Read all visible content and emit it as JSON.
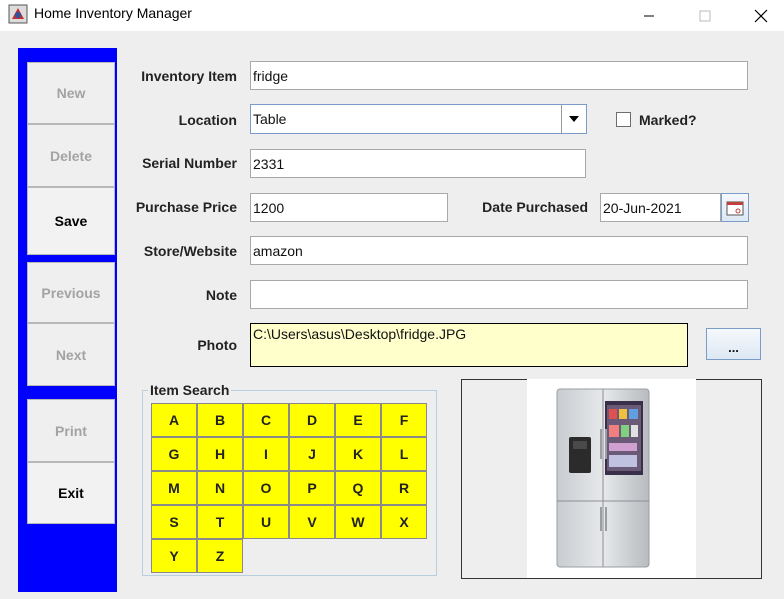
{
  "window": {
    "title": "Home Inventory Manager"
  },
  "sidebar": {
    "new": "New",
    "delete": "Delete",
    "save": "Save",
    "previous": "Previous",
    "next": "Next",
    "print": "Print",
    "exit": "Exit"
  },
  "form": {
    "inventory_item": {
      "label": "Inventory Item",
      "value": "fridge"
    },
    "location": {
      "label": "Location",
      "value": "Table"
    },
    "marked": {
      "label": "Marked?",
      "checked": false
    },
    "serial_number": {
      "label": "Serial Number",
      "value": "2331"
    },
    "purchase_price": {
      "label": "Purchase Price",
      "value": "1200"
    },
    "date_purchased": {
      "label": "Date Purchased",
      "value": "20-Jun-2021"
    },
    "store_website": {
      "label": "Store/Website",
      "value": "amazon"
    },
    "note": {
      "label": "Note",
      "value": ""
    },
    "photo": {
      "label": "Photo",
      "value": "C:\\Users\\asus\\Desktop\\fridge.JPG",
      "browse_label": "..."
    }
  },
  "search": {
    "title": "Item Search",
    "letters": [
      "A",
      "B",
      "C",
      "D",
      "E",
      "F",
      "G",
      "H",
      "I",
      "J",
      "K",
      "L",
      "M",
      "N",
      "O",
      "P",
      "Q",
      "R",
      "S",
      "T",
      "U",
      "V",
      "W",
      "X",
      "Y",
      "Z"
    ],
    "button_color": "#ffff00"
  },
  "colors": {
    "sidebar": "#0000ff",
    "photo_field": "#ffffcc"
  }
}
